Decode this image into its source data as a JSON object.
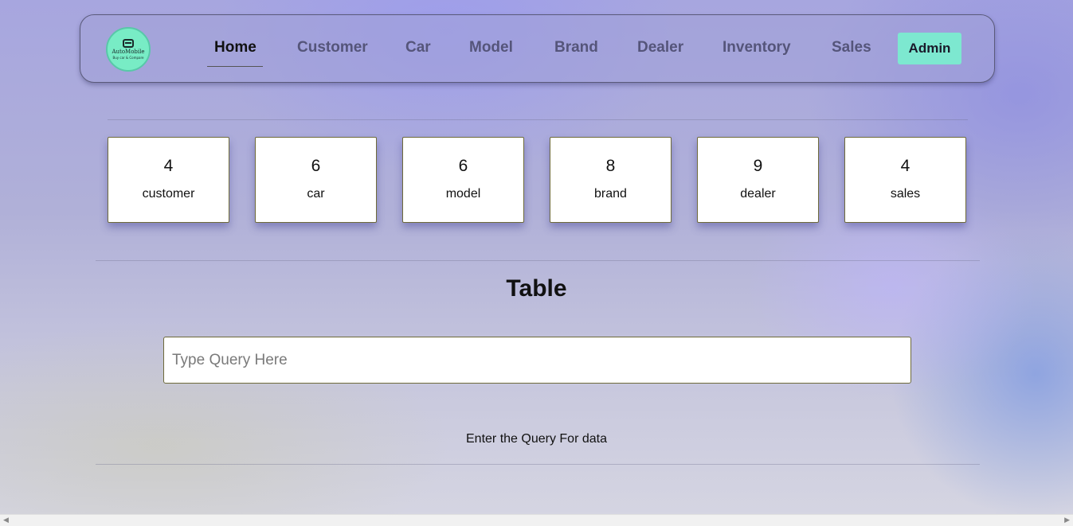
{
  "logo": {
    "name": "AutoMobile",
    "tagline": "Buy car & Compare"
  },
  "nav": {
    "items": [
      {
        "label": "Home",
        "active": true
      },
      {
        "label": "Customer"
      },
      {
        "label": "Car"
      },
      {
        "label": "Model"
      },
      {
        "label": "Brand"
      },
      {
        "label": "Dealer"
      },
      {
        "label": "Inventory"
      },
      {
        "label": "Sales"
      }
    ],
    "admin_label": "Admin"
  },
  "stats": [
    {
      "count": "4",
      "label": "customer"
    },
    {
      "count": "6",
      "label": "car"
    },
    {
      "count": "6",
      "label": "model"
    },
    {
      "count": "8",
      "label": "brand"
    },
    {
      "count": "9",
      "label": "dealer"
    },
    {
      "count": "4",
      "label": "sales"
    }
  ],
  "table": {
    "title": "Table",
    "query_placeholder": "Type Query Here",
    "query_value": "",
    "hint": "Enter the Query For data"
  },
  "colors": {
    "admin_button": "#7de8d0",
    "logo_bg": "#78ecc5",
    "nav_inactive": "#55557a"
  }
}
